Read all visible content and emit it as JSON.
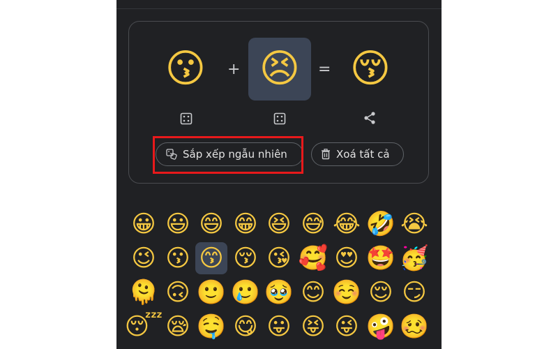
{
  "mixer": {
    "left_emoji": "😗",
    "left_emoji_icon": "kissing-face-icon",
    "plus": "+",
    "right_emoji": "😣",
    "right_emoji_icon": "persevering-face-icon",
    "equals": "=",
    "result_emoji": "😚",
    "result_emoji_icon": "kissing-face-closed-eyes-icon",
    "left_dice_icon": "dice-icon",
    "right_dice_icon": "dice-icon",
    "share_icon": "share-icon"
  },
  "actions": {
    "shuffle_label": "Sắp xếp ngẫu nhiên",
    "shuffle_icon": "shuffle-dice-icon",
    "clear_label": "Xoá tất cả",
    "clear_icon": "trash-icon"
  },
  "colors": {
    "background": "#202124",
    "selected": "#3c4556",
    "highlight": "#e8191b",
    "border": "#5f6368"
  },
  "emoji_grid": {
    "selected_index": 11,
    "rows": [
      [
        "😀",
        "😃",
        "😄",
        "😁",
        "😆",
        "😅",
        "😂",
        "🤣",
        "😭"
      ],
      [
        "😉",
        "😗",
        "😙",
        "😚",
        "😘",
        "🥰",
        "😍",
        "🤩",
        "🥳"
      ],
      [
        "🫠",
        "🙃",
        "🙂",
        "🥲",
        "🥹",
        "😊",
        "☺️",
        "😌",
        "😏"
      ],
      [
        "😴",
        "😪",
        "🤤",
        "😋",
        "😛",
        "😝",
        "😜",
        "🤪",
        "🥴"
      ]
    ]
  }
}
